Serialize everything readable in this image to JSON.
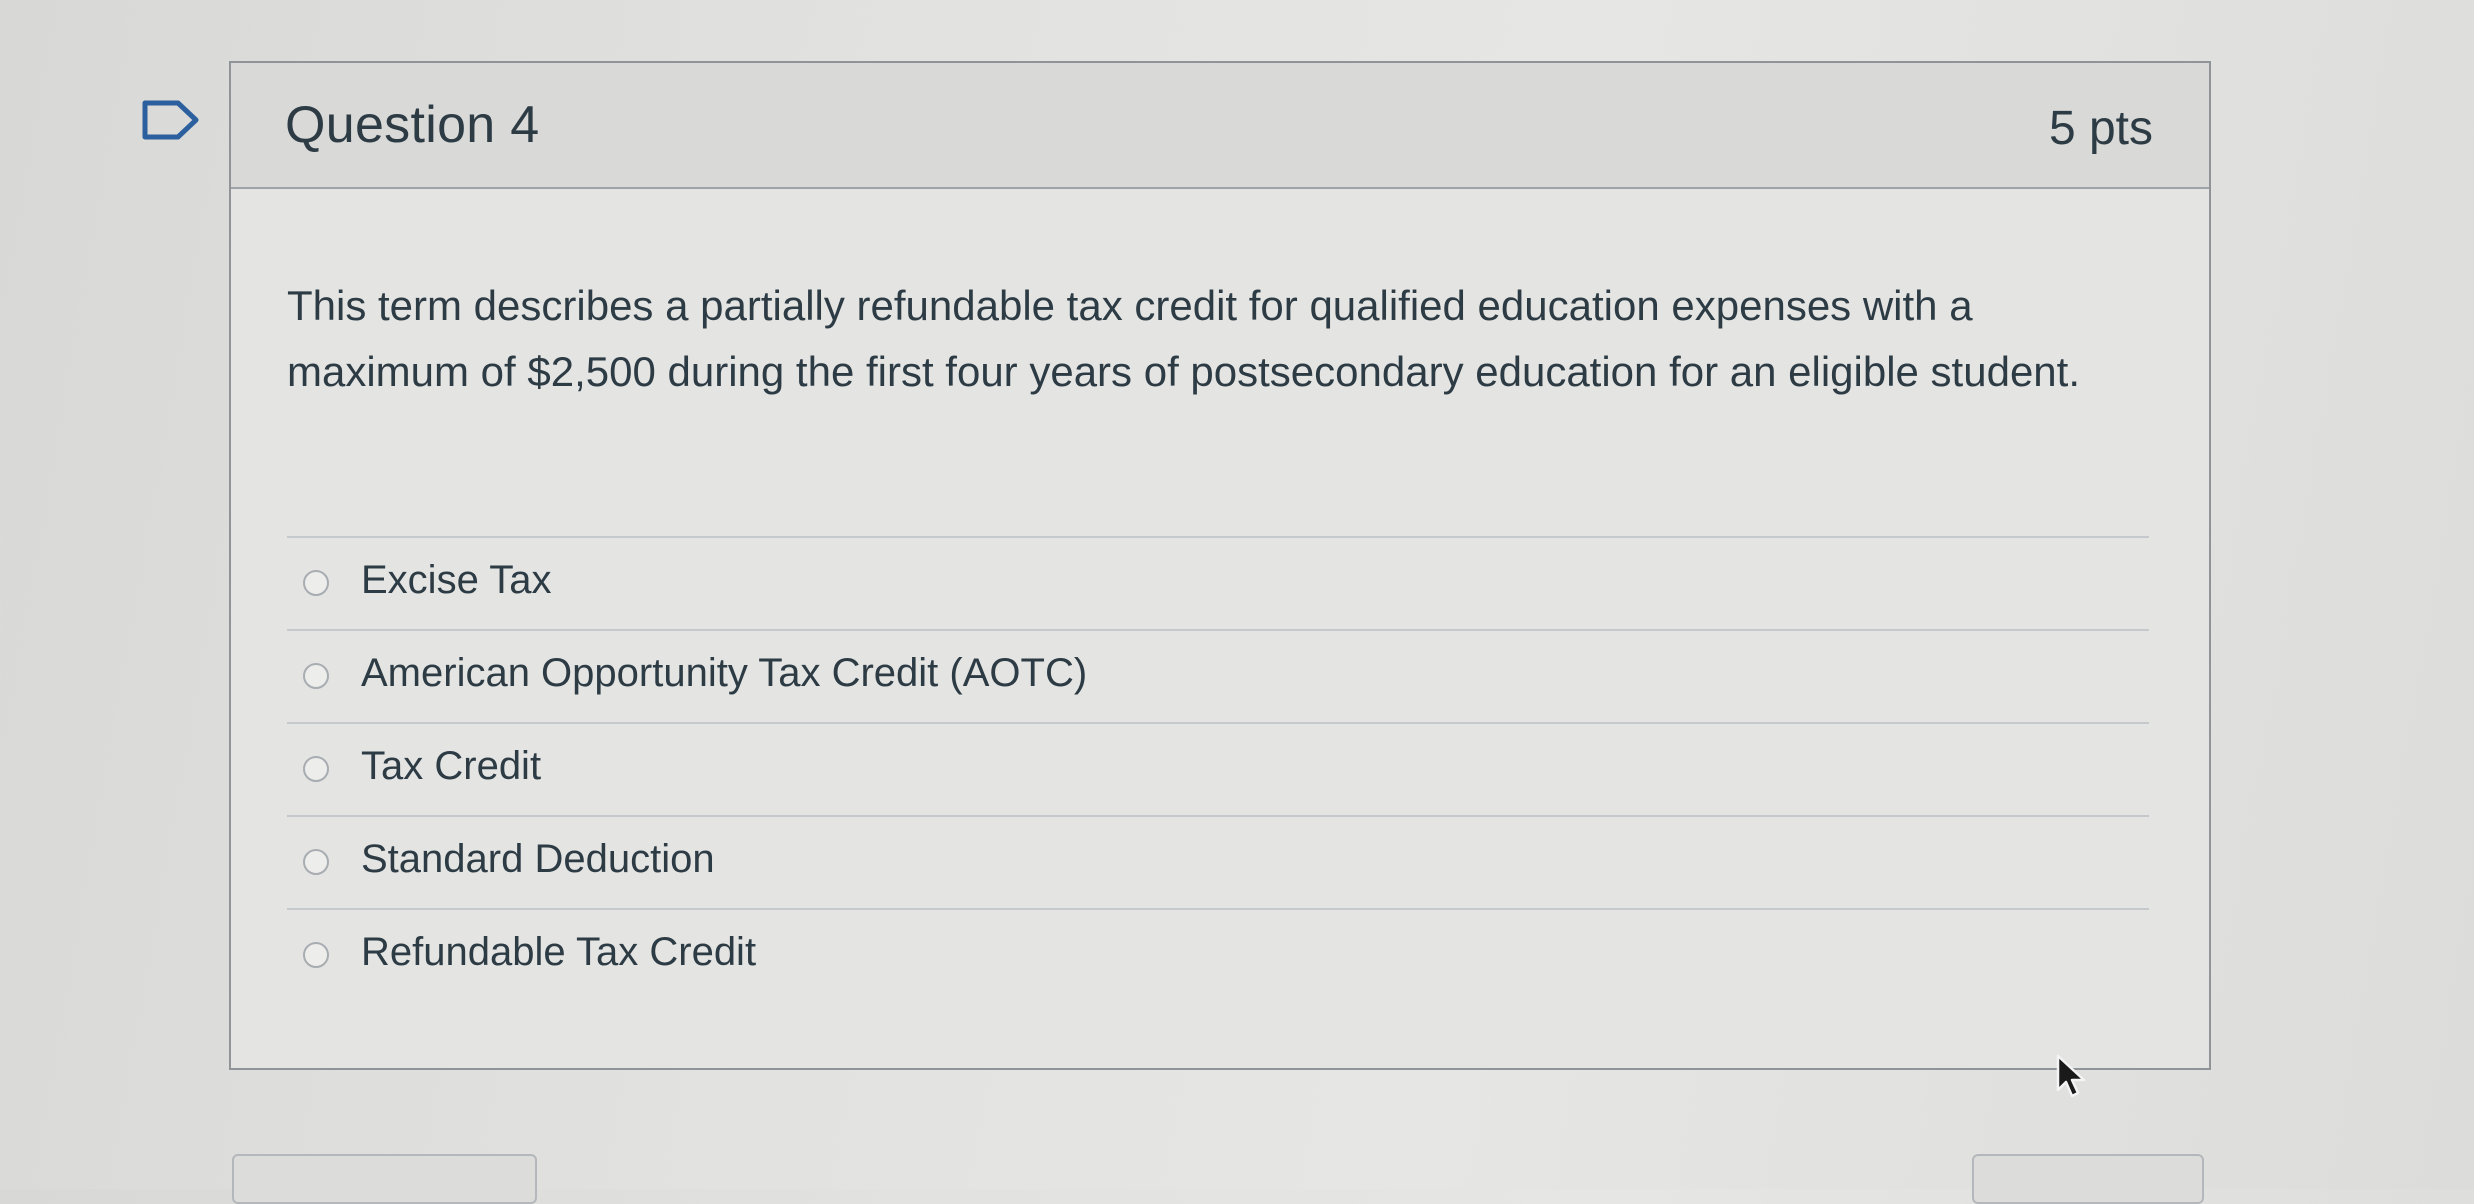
{
  "question": {
    "title": "Question 4",
    "points": "5 pts",
    "text": "This term describes a partially refundable tax credit for qualified education expenses with a maximum of $2,500 during the first four years of postsecondary education for an eligible student."
  },
  "answers": [
    {
      "label": "Excise Tax",
      "selected": false
    },
    {
      "label": "American Opportunity Tax Credit (AOTC)",
      "selected": false
    },
    {
      "label": "Tax Credit",
      "selected": false
    },
    {
      "label": "Standard Deduction",
      "selected": false
    },
    {
      "label": "Refundable Tax Credit",
      "selected": false
    }
  ],
  "icons": {
    "flag": "flag-icon",
    "cursor": "mouse-cursor-icon",
    "radio": "radio-icon"
  },
  "colors": {
    "text": "#2d3b45",
    "header_bg": "#d9d9d7",
    "card_border": "#8f9499",
    "divider": "#c6c9cc"
  }
}
